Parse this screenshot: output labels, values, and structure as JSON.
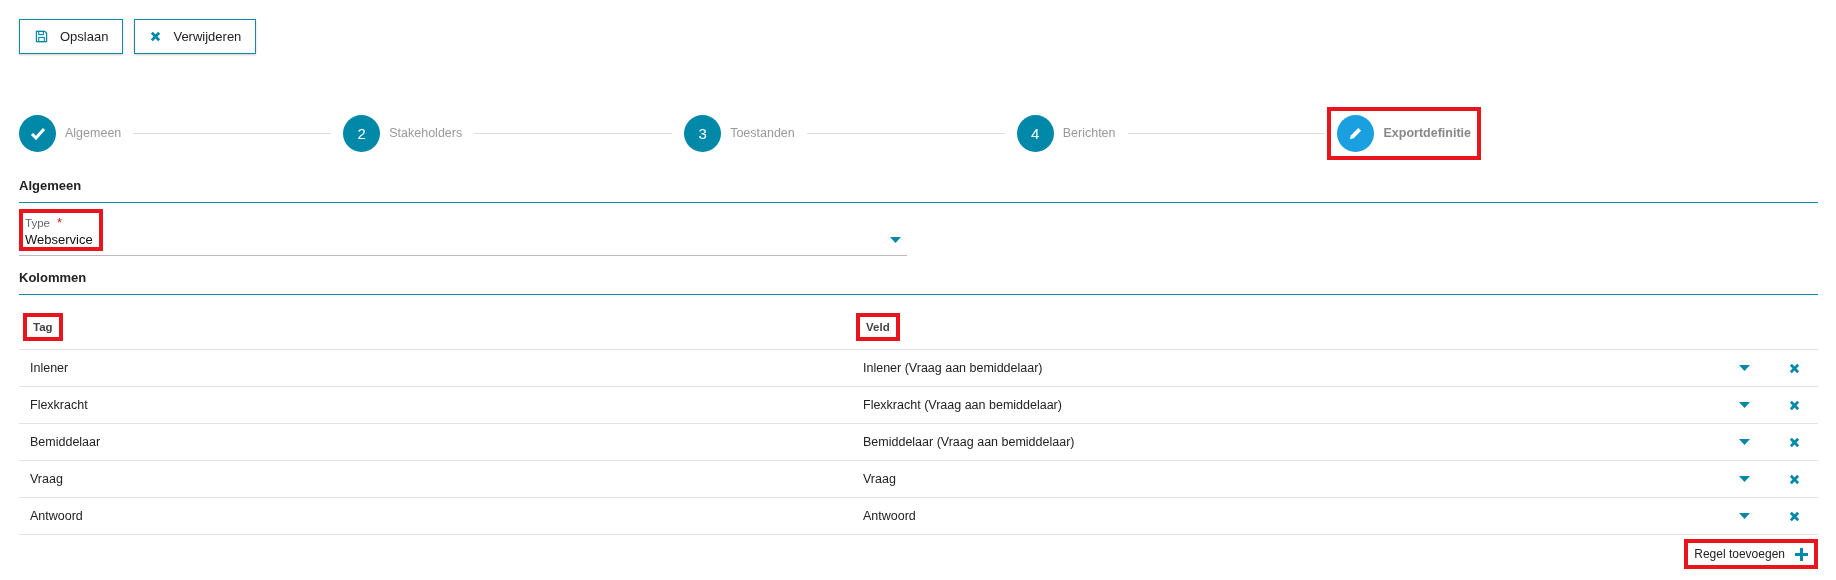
{
  "toolbar": [
    {
      "label": "Opslaan",
      "kind": "save"
    },
    {
      "label": "Verwijderen",
      "kind": "delete"
    }
  ],
  "steps": [
    {
      "label": "Algemeen",
      "kind": "done",
      "highlighted": false
    },
    {
      "number": "2",
      "label": "Stakeholders",
      "kind": "number",
      "highlighted": false
    },
    {
      "number": "3",
      "label": "Toestanden",
      "kind": "number",
      "highlighted": false
    },
    {
      "number": "4",
      "label": "Berichten",
      "kind": "number",
      "highlighted": false
    },
    {
      "label": "Exportdefinitie",
      "kind": "current",
      "highlighted": true
    }
  ],
  "general": {
    "title": "Algemeen",
    "type_field": {
      "label": "Type",
      "required_marker": "*",
      "value": "Webservice",
      "highlighted": true
    }
  },
  "columns_section": {
    "title": "Kolommen",
    "columns": [
      {
        "label": "Tag",
        "highlighted": true
      },
      {
        "label": "Veld",
        "highlighted": true
      }
    ],
    "rows": [
      {
        "tag": "Inlener",
        "field": "Inlener (Vraag aan bemiddelaar)"
      },
      {
        "tag": "Flexkracht",
        "field": "Flexkracht (Vraag aan bemiddelaar)"
      },
      {
        "tag": "Bemiddelaar",
        "field": "Bemiddelaar (Vraag aan bemiddelaar)"
      },
      {
        "tag": "Vraag",
        "field": "Vraag"
      },
      {
        "tag": "Antwoord",
        "field": "Antwoord"
      }
    ],
    "add_button": {
      "label": "Regel toevoegen",
      "highlighted": true
    }
  }
}
